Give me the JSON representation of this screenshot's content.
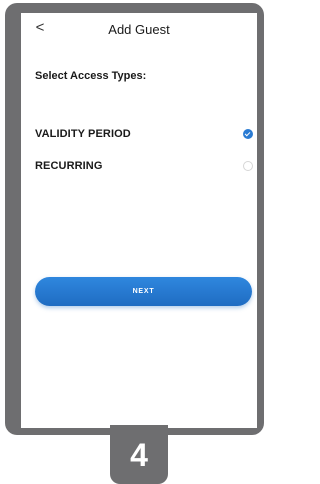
{
  "header": {
    "back_icon": "<",
    "title": "Add Guest"
  },
  "content": {
    "subtitle": "Select Access Types:",
    "options": [
      {
        "label": "VALIDITY PERIOD",
        "selected": true
      },
      {
        "label": "RECURRING",
        "selected": false
      }
    ]
  },
  "actions": {
    "next_label": "NEXT"
  },
  "step": {
    "number": "4"
  },
  "colors": {
    "accent": "#2a7bd3",
    "frame": "#6e6e70"
  }
}
